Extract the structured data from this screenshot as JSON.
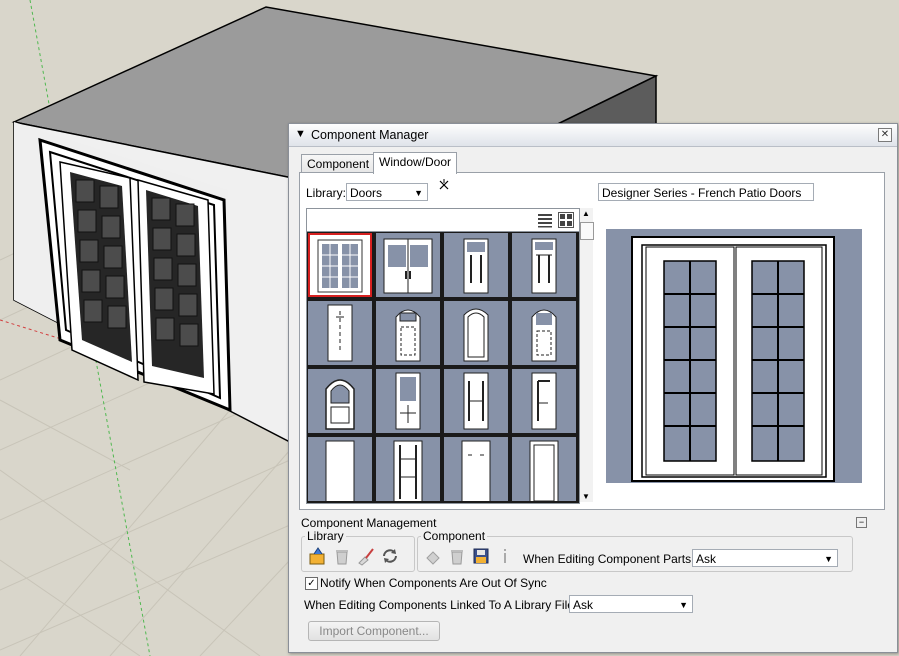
{
  "panel": {
    "title": "Component Manager",
    "collapse_icon": "triangle-down-icon",
    "close_icon": "close-icon"
  },
  "tabs": [
    {
      "label": "Component"
    },
    {
      "label": "Window/Door"
    }
  ],
  "library": {
    "label": "Library:",
    "selected": "Doors"
  },
  "component_name": "Designer Series - French Patio Doors",
  "thumbnails": [
    "french-double-door",
    "double-door-handle",
    "narrow-door-mullions",
    "panel-door",
    "plain-door",
    "arched-glass-door",
    "tall-arched-door",
    "arched-panel-door",
    "arched-window-door",
    "split-glass-door",
    "raised-panel-door",
    "offset-panel-door",
    "blank-door",
    "ladder-door",
    "flush-door",
    "solid-door"
  ],
  "management": {
    "title": "Component Management",
    "library_group": "Library",
    "component_group": "Component",
    "editing_parts_label": "When Editing Component Parts:",
    "editing_parts_value": "Ask",
    "notify_label": "Notify When Components Are Out Of Sync",
    "notify_checked": true,
    "linked_label": "When Editing Components Linked To A Library File:",
    "linked_value": "Ask",
    "import_button": "Import Component..."
  },
  "colors": {
    "thumb_bg": "#8792a8",
    "selection": "#d62020",
    "panel_bg": "#f0f0f0"
  }
}
